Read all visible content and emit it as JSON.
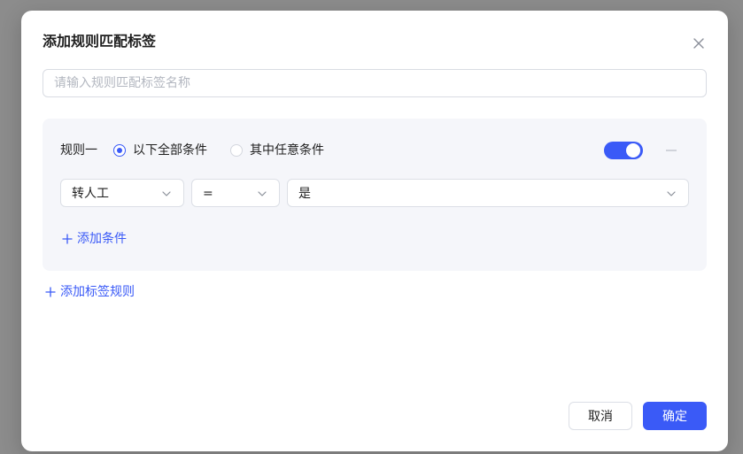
{
  "dialog": {
    "title": "添加规则匹配标签",
    "name_input": {
      "placeholder": "请输入规则匹配标签名称",
      "value": ""
    }
  },
  "rules": [
    {
      "label": "规则一",
      "match_mode": {
        "options": [
          {
            "label": "以下全部条件",
            "checked": true
          },
          {
            "label": "其中任意条件",
            "checked": false
          }
        ]
      },
      "enabled": true,
      "conditions": [
        {
          "field": "转人工",
          "operator": "=",
          "value": "是"
        }
      ],
      "add_condition_label": "添加条件"
    }
  ],
  "add_rule_label": "添加标签规则",
  "footer": {
    "cancel_label": "取消",
    "ok_label": "确定"
  },
  "colors": {
    "accent": "#3a5af7",
    "card_bg": "#f5f6fa",
    "backdrop": "#8c8c8c"
  },
  "icons": {
    "close": "close-icon",
    "dropdown": "chevron-down-icon",
    "add": "plus-icon",
    "remove": "minus-icon"
  }
}
